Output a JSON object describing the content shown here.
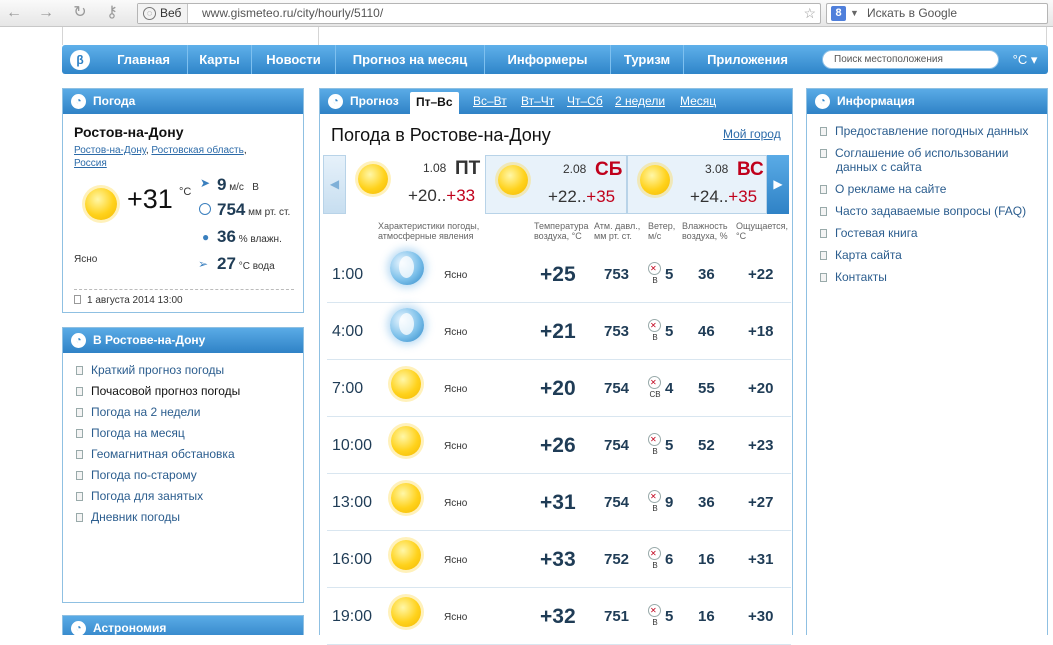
{
  "browser": {
    "url": "www.gismeteo.ru/city/hourly/5110/",
    "site_badge": "Веб",
    "search_placeholder": "Искать в Google",
    "search_engine_letter": "8"
  },
  "nav": {
    "logo": "β",
    "items": [
      "Главная",
      "Карты",
      "Новости",
      "Прогноз на месяц",
      "Информеры",
      "Туризм",
      "Приложения"
    ],
    "search_placeholder": "Поиск местоположения",
    "unit": "°C ▾"
  },
  "weather": {
    "title": "Погода",
    "city": "Ростов-на-Дону",
    "region1": "Ростов-на-Дону",
    "region2": "Ростовская область",
    "country": "Россия",
    "temp": "+31",
    "temp_unit": "°C",
    "wind": "9",
    "wind_unit": "м/с",
    "wind_dir": "В",
    "pressure": "754",
    "pressure_unit": "мм рт. ст.",
    "humidity": "36",
    "humidity_unit": "% влажн.",
    "water": "27",
    "water_unit": "°C вода",
    "condition": "Ясно",
    "updated": "1 августа 2014 13:00"
  },
  "city_box": {
    "title": "В Ростове-на-Дону",
    "items": [
      "Краткий прогноз погоды",
      "Почасовой прогноз погоды",
      "Погода на 2 недели",
      "Погода на месяц",
      "Геомагнитная обстановка",
      "Погода по-старому",
      "Погода для занятых",
      "Дневник погоды"
    ]
  },
  "astro": {
    "title": "Астрономия"
  },
  "forecast": {
    "title": "Прогноз",
    "tabs": [
      "Пт–Вс",
      "Вс–Вт",
      "Вт–Чт",
      "Чт–Сб",
      "2 недели",
      "Месяц"
    ],
    "heading": "Погода в Ростове-на-Дону",
    "my_city": "Мой город",
    "days": [
      {
        "date": "1.08",
        "name": "ПТ",
        "min": "+20",
        "max": "+33",
        "name_color": "#333333"
      },
      {
        "date": "2.08",
        "name": "СБ",
        "min": "+22",
        "max": "+35",
        "name_color": "#c0001b"
      },
      {
        "date": "3.08",
        "name": "ВС",
        "min": "+24",
        "max": "+35",
        "name_color": "#c0001b"
      }
    ],
    "headers": {
      "cond": "Характеристики погоды, атмосферные явления",
      "temp": "Температура воздуха, °С",
      "press": "Атм. давл., мм рт. ст.",
      "wind": "Ветер, м/с",
      "hum": "Влажность воздуха, %",
      "feel": "Ощущается, °С"
    },
    "rows": [
      {
        "time": "1:00",
        "icon": "moon-icon",
        "cond": "Ясно",
        "temp": "+25",
        "press": "753",
        "wind_dir": "В",
        "wind": "5",
        "hum": "36",
        "feel": "+22"
      },
      {
        "time": "4:00",
        "icon": "moon-icon",
        "cond": "Ясно",
        "temp": "+21",
        "press": "753",
        "wind_dir": "В",
        "wind": "5",
        "hum": "46",
        "feel": "+18"
      },
      {
        "time": "7:00",
        "icon": "sun-icon",
        "cond": "Ясно",
        "temp": "+20",
        "press": "754",
        "wind_dir": "СВ",
        "wind": "4",
        "hum": "55",
        "feel": "+20"
      },
      {
        "time": "10:00",
        "icon": "sun-icon",
        "cond": "Ясно",
        "temp": "+26",
        "press": "754",
        "wind_dir": "В",
        "wind": "5",
        "hum": "52",
        "feel": "+23"
      },
      {
        "time": "13:00",
        "icon": "sun-icon",
        "cond": "Ясно",
        "temp": "+31",
        "press": "754",
        "wind_dir": "В",
        "wind": "9",
        "hum": "36",
        "feel": "+27"
      },
      {
        "time": "16:00",
        "icon": "sun-icon",
        "cond": "Ясно",
        "temp": "+33",
        "press": "752",
        "wind_dir": "В",
        "wind": "6",
        "hum": "16",
        "feel": "+31"
      },
      {
        "time": "19:00",
        "icon": "sun-icon",
        "cond": "Ясно",
        "temp": "+32",
        "press": "751",
        "wind_dir": "В",
        "wind": "5",
        "hum": "16",
        "feel": "+30"
      }
    ]
  },
  "info": {
    "title": "Информация",
    "items": [
      "Предоставление погодных данных",
      "Соглашение об использовании данных с сайта",
      "О рекламе на сайте",
      "Часто задаваемые вопросы (FAQ)",
      "Гостевая книга",
      "Карта сайта",
      "Контакты"
    ]
  }
}
